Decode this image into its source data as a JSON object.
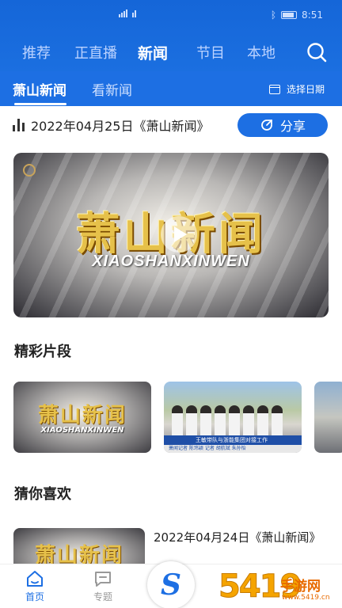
{
  "status_bar": {
    "time": "8:51"
  },
  "channels": [
    "推荐",
    "正直播",
    "新闻",
    "节目",
    "本地"
  ],
  "subtabs": [
    "萧山新闻",
    "看新闻"
  ],
  "date_picker_label": "选择日期",
  "episode": {
    "title": "2022年04月25日《萧山新闻》",
    "share_label": "分享"
  },
  "video": {
    "title": "萧山新闻",
    "pinyin": "XIAOSHANXINWEN"
  },
  "sections": {
    "highlights": "精彩片段",
    "guess": "猜你喜欢"
  },
  "clips": [
    {
      "title": "萧山新闻",
      "pinyin": "XIAOSHANXINWEN"
    },
    {
      "caption": "王敏带队与浙能集团对接工作",
      "subcaption": "萧闻记者 陈玮颖 记者 胡航斌 朱孙怡"
    }
  ],
  "recommend": {
    "title": "2022年04月24日《萧山新闻》",
    "thumb_title": "萧山新闻"
  },
  "bottom_nav": [
    {
      "label": "首页"
    },
    {
      "label": "专题"
    }
  ],
  "watermark": {
    "number": "5419",
    "text": "手游网",
    "url": "www.5419.cn"
  },
  "colors": {
    "brand_blue": "#1d6fe3",
    "gold": "#e6c14a",
    "watermark_orange": "#f5a400"
  },
  "icons": {
    "search": "search-icon",
    "calendar": "calendar-icon",
    "chart": "bars-icon",
    "share": "share-icon",
    "play": "play-icon",
    "home": "home-icon",
    "topic": "chat-icon"
  }
}
